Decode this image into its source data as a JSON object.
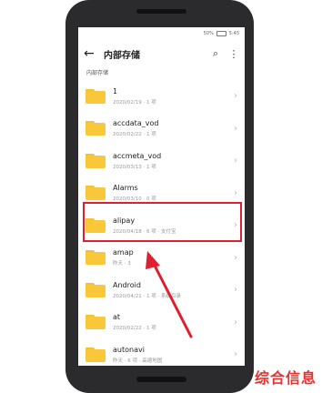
{
  "status": {
    "battery": "50%",
    "time": "5:45"
  },
  "header": {
    "back_icon": "back-arrow-icon",
    "title": "内部存储",
    "search_icon": "search-icon",
    "more_icon": "more-vert-icon"
  },
  "path": "内部存储",
  "files": [
    {
      "name": "1",
      "meta": "2020/02/19 · 1 项"
    },
    {
      "name": "accdata_vod",
      "meta": "2020/02/22 · 1 项"
    },
    {
      "name": "accmeta_vod",
      "meta": "2020/03/13 · 1 项"
    },
    {
      "name": "Alarms",
      "meta": "2020/03/10 · 0 项"
    },
    {
      "name": "alipay",
      "meta": "2020/04/18 · 6 项 · 支付宝"
    },
    {
      "name": "amap",
      "meta": "昨天 · 3"
    },
    {
      "name": "Android",
      "meta": "2020/04/21 · 1 项 · 系统目录"
    },
    {
      "name": "at",
      "meta": "2020/02/22 · 1 项"
    },
    {
      "name": "autonavi",
      "meta": "昨天 · 6 项 · 高德地图"
    }
  ],
  "watermark": "综合信息",
  "colors": {
    "highlight": "#e01e2d",
    "folder": "#f9c83a"
  }
}
